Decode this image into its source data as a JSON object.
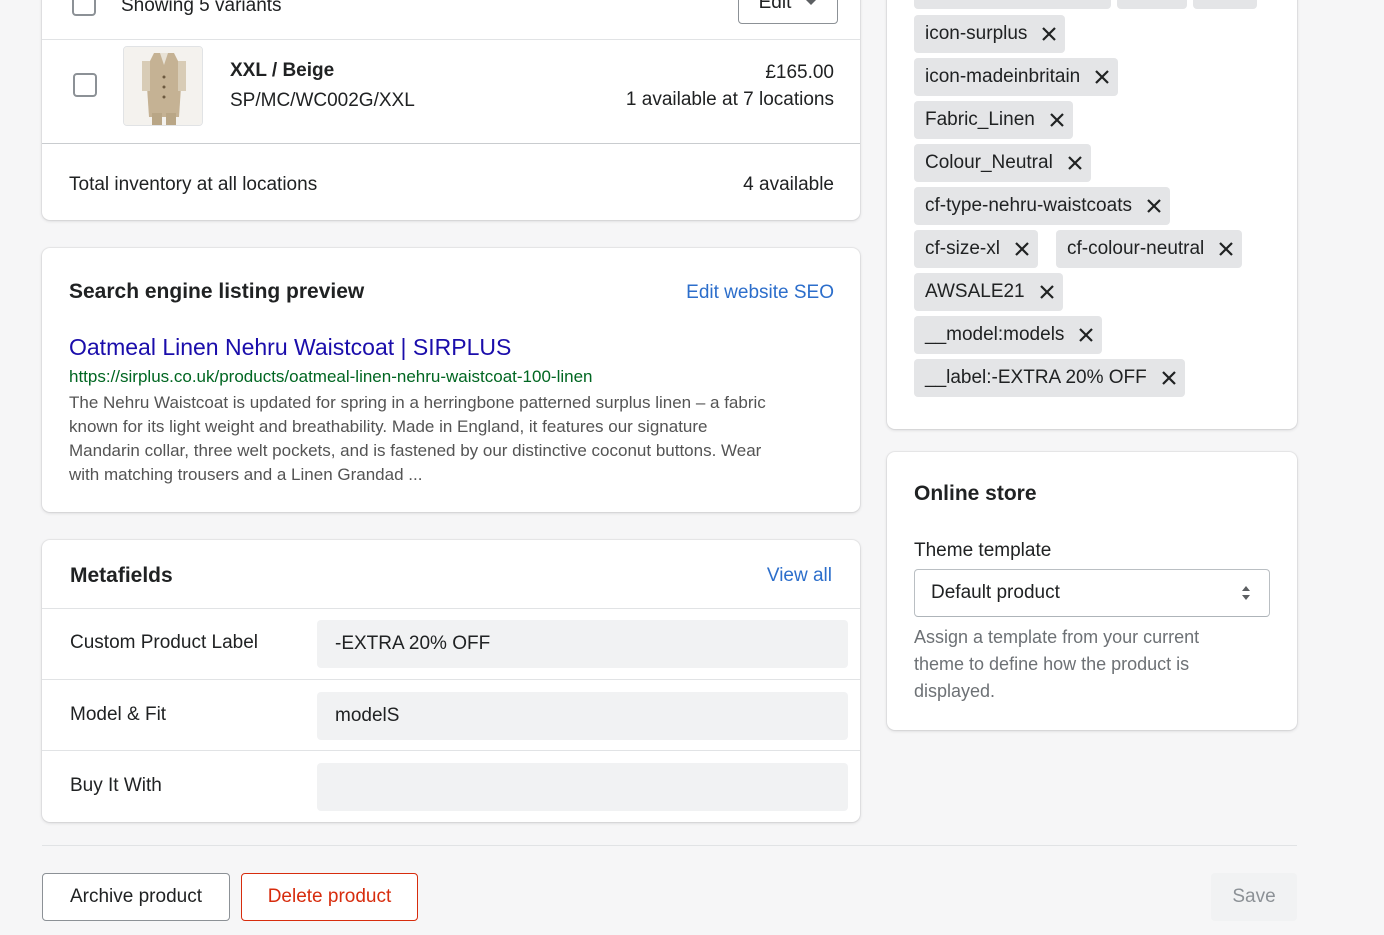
{
  "variants_card": {
    "showing_label": "Showing 5 variants",
    "edit_button": "Edit",
    "variant": {
      "title": "XXL / Beige",
      "sku": "SP/MC/WC002G/XXL",
      "price": "£165.00",
      "availability": "1 available at 7 locations"
    },
    "total_label": "Total inventory at all locations",
    "total_value": "4 available"
  },
  "seo": {
    "heading": "Search engine listing preview",
    "edit_link": "Edit website SEO",
    "page_title": "Oatmeal Linen Nehru Waistcoat | SIRPLUS",
    "url": "https://sirplus.co.uk/products/oatmeal-linen-nehru-waistcoat-100-linen",
    "description_lines": [
      "The Nehru Waistcoat is updated for spring in a herringbone patterned surplus linen – a fabric",
      "known for its light weight and breathability. Made in England, it features our signature",
      "Mandarin collar, three welt pockets, and is fastened by our distinctive coconut buttons. Wear",
      "with matching trousers and a Linen Grandad ..."
    ]
  },
  "metafields": {
    "heading": "Metafields",
    "view_all": "View all",
    "rows": [
      {
        "label": "Custom Product Label",
        "value": "-EXTRA 20% OFF"
      },
      {
        "label": "Model & Fit",
        "value": "modelS"
      },
      {
        "label": "Buy It With",
        "value": ""
      }
    ]
  },
  "tags": [
    "icon-surplus",
    "icon-madeinbritain",
    "Fabric_Linen",
    "Colour_Neutral",
    "cf-type-nehru-waistcoats",
    "cf-size-xl",
    "cf-colour-neutral",
    "AWSALE21",
    "__model:models",
    "__label:-EXTRA 20% OFF"
  ],
  "online_store": {
    "heading": "Online store",
    "template_label": "Theme template",
    "template_value": "Default product",
    "help_lines": [
      "Assign a template from your current",
      "theme to define how the product is",
      "displayed."
    ]
  },
  "footer": {
    "archive": "Archive product",
    "delete": "Delete product",
    "save": "Save"
  },
  "colors": {
    "link": "#2c6ecb",
    "seo_title": "#1a0dab",
    "seo_url": "#006621",
    "danger": "#d72c0d"
  }
}
